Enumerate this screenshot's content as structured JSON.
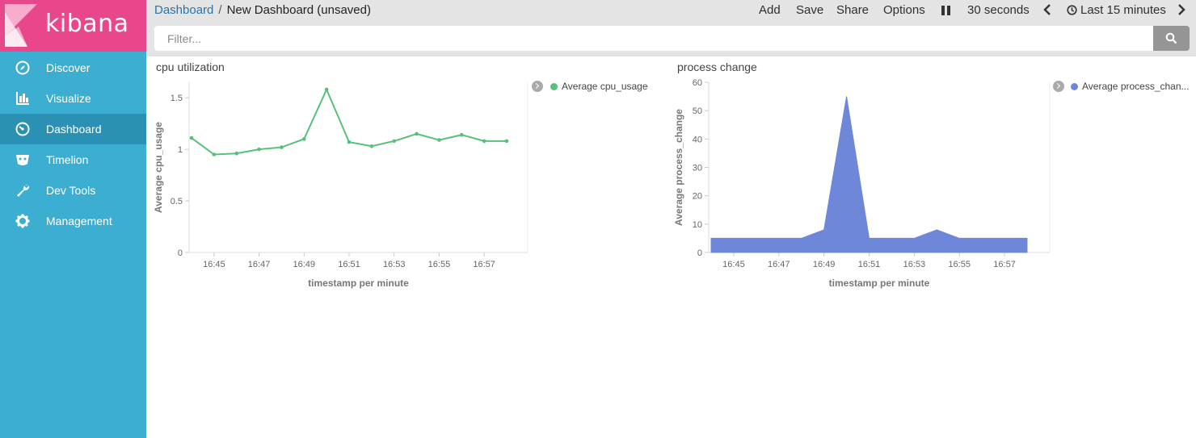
{
  "app": {
    "logo_text": "kibana"
  },
  "sidebar": {
    "items": [
      {
        "label": "Discover",
        "icon": "compass-icon",
        "active": false
      },
      {
        "label": "Visualize",
        "icon": "bar-chart-icon",
        "active": false
      },
      {
        "label": "Dashboard",
        "icon": "dashboard-gauge-icon",
        "active": true
      },
      {
        "label": "Timelion",
        "icon": "timelion-icon",
        "active": false
      },
      {
        "label": "Dev Tools",
        "icon": "wrench-icon",
        "active": false
      },
      {
        "label": "Management",
        "icon": "gear-icon",
        "active": false
      }
    ]
  },
  "header": {
    "breadcrumb": {
      "parent": "Dashboard",
      "separator": "/",
      "current": "New Dashboard (unsaved)"
    },
    "menu": {
      "add": "Add",
      "save": "Save",
      "share": "Share",
      "options": "Options"
    },
    "refresh_interval": "30 seconds",
    "time_range": "Last 15 minutes",
    "filter": {
      "placeholder": "Filter...",
      "value": ""
    }
  },
  "colors": {
    "sidebar": "#3caed2",
    "sidebar_active": "#2a91b5",
    "logo_bg": "#e8478b",
    "cpu_series": "#57c17b",
    "process_series": "#6f87d8"
  },
  "panels": [
    {
      "title": "cpu utilization",
      "legend": "Average cpu_usage"
    },
    {
      "title": "process change",
      "legend": "Average process_chan..."
    }
  ],
  "chart_data": [
    {
      "type": "line",
      "title": "cpu utilization",
      "xlabel": "timestamp per minute",
      "ylabel": "Average cpu_usage",
      "x": [
        "16:44",
        "16:45",
        "16:46",
        "16:47",
        "16:48",
        "16:49",
        "16:50",
        "16:51",
        "16:52",
        "16:53",
        "16:54",
        "16:55",
        "16:56",
        "16:57",
        "16:58"
      ],
      "x_ticks": [
        "16:45",
        "16:47",
        "16:49",
        "16:51",
        "16:53",
        "16:55",
        "16:57"
      ],
      "y_ticks": [
        "0",
        "0.5",
        "1",
        "1.5"
      ],
      "ylim": [
        0,
        1.65
      ],
      "series": [
        {
          "name": "Average cpu_usage",
          "color": "#57c17b",
          "values": [
            1.11,
            0.95,
            0.96,
            1.0,
            1.02,
            1.1,
            1.58,
            1.07,
            1.03,
            1.08,
            1.15,
            1.09,
            1.14,
            1.08,
            1.08
          ]
        }
      ],
      "grid": false,
      "legend_position": "right"
    },
    {
      "type": "area",
      "title": "process change",
      "xlabel": "timestamp per minute",
      "ylabel": "Average process_change",
      "x": [
        "16:44",
        "16:45",
        "16:46",
        "16:47",
        "16:48",
        "16:49",
        "16:50",
        "16:51",
        "16:52",
        "16:53",
        "16:54",
        "16:55",
        "16:56",
        "16:57",
        "16:58"
      ],
      "x_ticks": [
        "16:45",
        "16:47",
        "16:49",
        "16:51",
        "16:53",
        "16:55",
        "16:57"
      ],
      "y_ticks": [
        "0",
        "10",
        "20",
        "30",
        "40",
        "50",
        "60"
      ],
      "ylim": [
        0,
        60
      ],
      "series": [
        {
          "name": "Average process_change",
          "color": "#6f87d8",
          "values": [
            5,
            5,
            5,
            5,
            5,
            8,
            55,
            5,
            5,
            5,
            8,
            5,
            5,
            5,
            5
          ]
        }
      ],
      "grid": false,
      "legend_position": "right"
    }
  ]
}
